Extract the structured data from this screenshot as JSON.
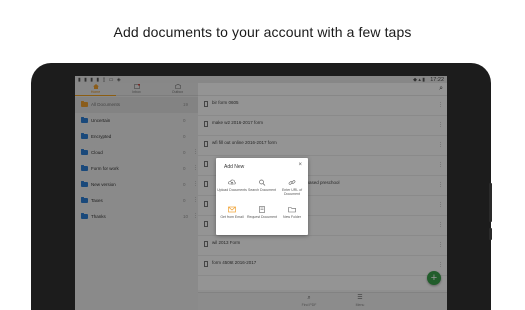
{
  "headline": "Add documents to your account with a few taps",
  "status_bar": {
    "time": "17:22",
    "left_icons": "▮ ▮ ▮ ▮ ▯ ▭ ◈",
    "right_icons": "◆ ▴ ▮"
  },
  "left_tabs": [
    {
      "label": "Home",
      "active": true
    },
    {
      "label": "Inbox",
      "active": false
    },
    {
      "label": "Outbox",
      "active": false
    }
  ],
  "folders": [
    {
      "name": "All Documents",
      "count": "19",
      "selected": true
    },
    {
      "name": "Uncertain",
      "count": "0",
      "selected": false
    },
    {
      "name": "Encrypted",
      "count": "0",
      "selected": false
    },
    {
      "name": "Cloud",
      "count": "0",
      "selected": false
    },
    {
      "name": "Form for work",
      "count": "0",
      "selected": false
    },
    {
      "name": "New version",
      "count": "0",
      "selected": false
    },
    {
      "name": "Taxes",
      "count": "0",
      "selected": false
    },
    {
      "name": "Thanks",
      "count": "10",
      "selected": false
    }
  ],
  "documents": [
    {
      "name": "bir form 0605",
      "date": ""
    },
    {
      "name": "make w2 2016-2017 form",
      "date": ""
    },
    {
      "name": "wfi fill out online 2016-2017 form",
      "date": ""
    },
    {
      "name": "",
      "date": ""
    },
    {
      "name": "ly based preschool",
      "date": ""
    },
    {
      "name": "",
      "date": ""
    },
    {
      "name": "",
      "date": ""
    },
    {
      "name": "wil 2013 Form",
      "date": ""
    },
    {
      "name": "form 4506t 2016-2017",
      "date": ""
    }
  ],
  "bottom_bar": [
    {
      "label": "Find PDF",
      "icon": "search-icon"
    },
    {
      "label": "Menu",
      "icon": "menu-icon"
    }
  ],
  "fab": {
    "symbol": "+"
  },
  "dialog": {
    "title": "Add New",
    "close": "×",
    "options": [
      {
        "label": "Upload Documents",
        "icon": "upload-icon"
      },
      {
        "label": "Search Document",
        "icon": "search-icon"
      },
      {
        "label": "Enter URL of Document",
        "icon": "link-icon"
      },
      {
        "label": "Get from Email",
        "icon": "email-icon"
      },
      {
        "label": "Request Document",
        "icon": "request-icon"
      },
      {
        "label": "New Folder",
        "icon": "folder-icon"
      }
    ]
  },
  "colors": {
    "accent_orange": "#f0a030",
    "folder_blue": "#2e7fd4",
    "fab_green": "#3aa04a"
  }
}
